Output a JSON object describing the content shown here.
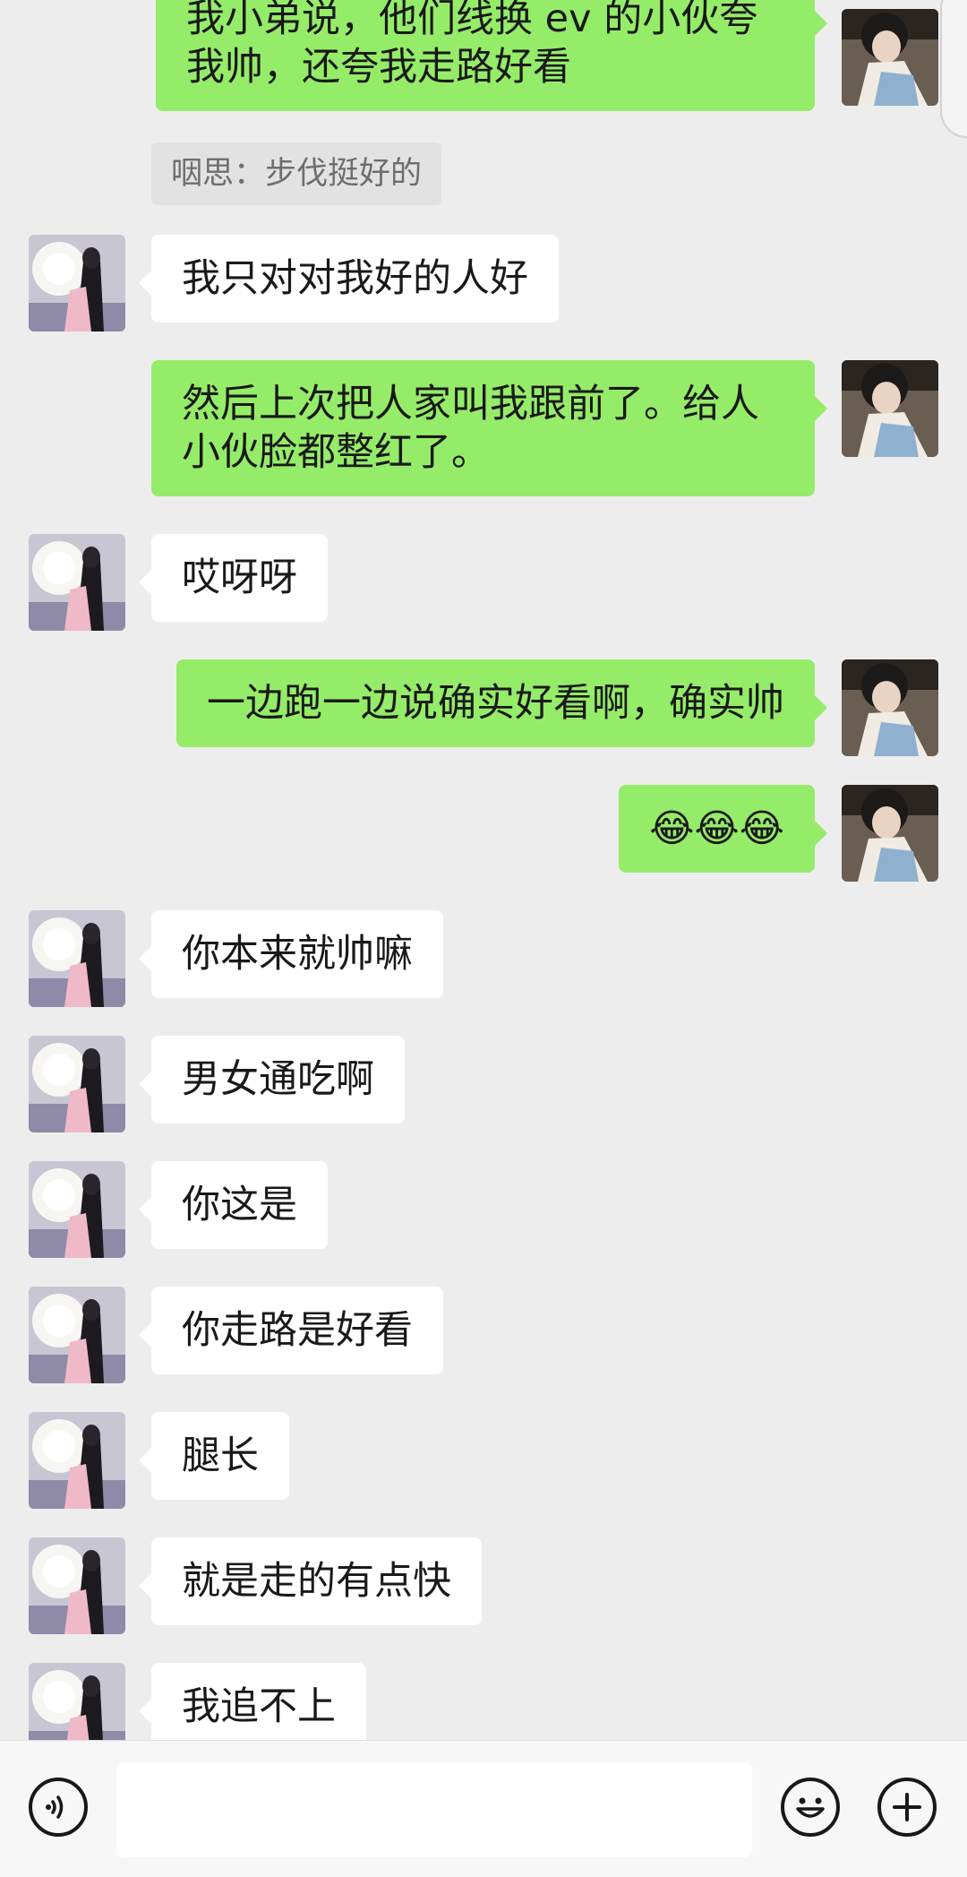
{
  "chat": {
    "messages": [
      {
        "side": "out",
        "text": "我小弟说，他们线换 ev 的小伙夸我帅，还夸我走路好看"
      },
      {
        "side": "quote",
        "text": "咽思：步伐挺好的"
      },
      {
        "side": "in",
        "text": "我只对对我好的人好"
      },
      {
        "side": "out",
        "text": "然后上次把人家叫我跟前了。给人小伙脸都整红了。"
      },
      {
        "side": "in",
        "text": "哎呀呀"
      },
      {
        "side": "out",
        "text": "一边跑一边说确实好看啊，确实帅"
      },
      {
        "side": "out",
        "text": "😂😂😂"
      },
      {
        "side": "in",
        "text": "你本来就帅嘛"
      },
      {
        "side": "in",
        "text": "男女通吃啊"
      },
      {
        "side": "in",
        "text": "你这是"
      },
      {
        "side": "in",
        "text": "你走路是好看"
      },
      {
        "side": "in",
        "text": "腿长"
      },
      {
        "side": "in",
        "text": "就是走的有点快"
      },
      {
        "side": "in",
        "text": "我追不上"
      }
    ]
  },
  "input_bar": {
    "voice_icon": "voice-icon",
    "emoji_icon": "emoji-icon",
    "plus_icon": "plus-icon",
    "text_value": ""
  },
  "colors": {
    "background": "#ededed",
    "outgoing_bubble": "#95ec69",
    "incoming_bubble": "#ffffff",
    "quote_bg": "#e2e2e2",
    "quote_text": "#6e6e6e",
    "input_bar_bg": "#f7f7f7"
  }
}
